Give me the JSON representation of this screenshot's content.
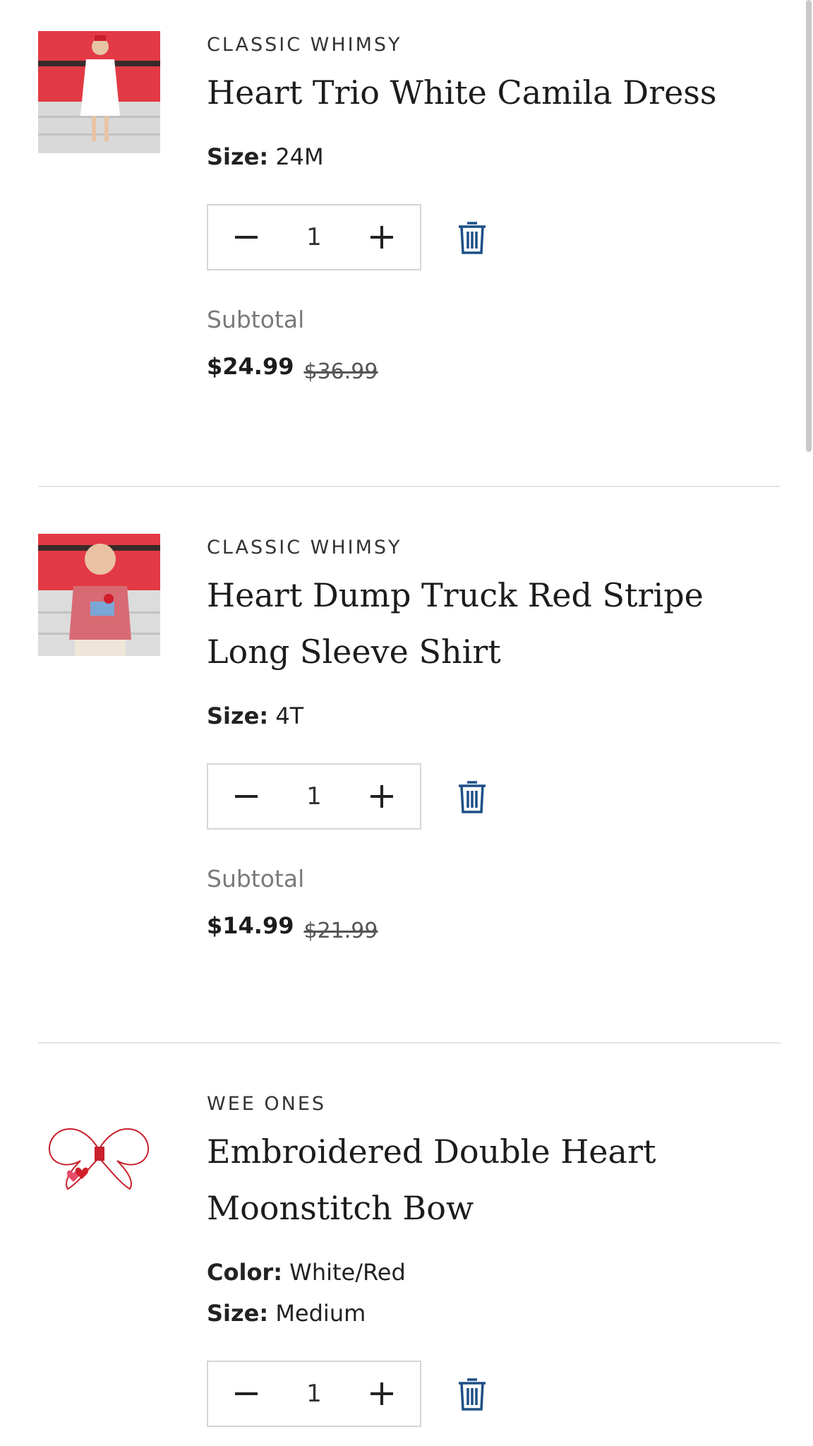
{
  "items": [
    {
      "brand": "CLASSIC WHIMSY",
      "title": "Heart Trio White Camila Dress",
      "options": [
        {
          "label": "Size:",
          "value": "24M"
        }
      ],
      "quantity": "1",
      "subtotal_label": "Subtotal",
      "price": "$24.99",
      "compare_price": "$36.99"
    },
    {
      "brand": "CLASSIC WHIMSY",
      "title": "Heart Dump Truck Red Stripe Long Sleeve Shirt",
      "options": [
        {
          "label": "Size:",
          "value": "4T"
        }
      ],
      "quantity": "1",
      "subtotal_label": "Subtotal",
      "price": "$14.99",
      "compare_price": "$21.99"
    },
    {
      "brand": "WEE ONES",
      "title": "Embroidered Double Heart Moonstitch Bow",
      "options": [
        {
          "label": "Color:",
          "value": "White/Red"
        },
        {
          "label": "Size:",
          "value": "Medium"
        }
      ],
      "quantity": "1"
    }
  ],
  "colors": {
    "icon_blue": "#1d4f86",
    "divider": "#e3e3e3"
  }
}
